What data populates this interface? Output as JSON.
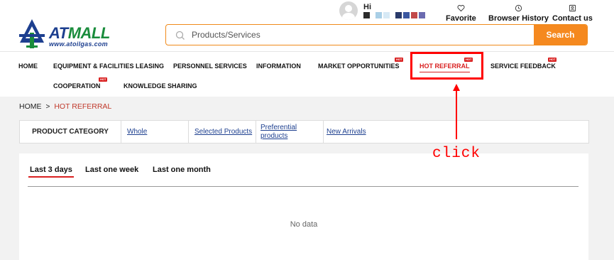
{
  "brand": {
    "logo_name": "AT",
    "logo_name2": "MALL",
    "logo_url": "www.atoilgas.com",
    "primary": "#1d3f8f",
    "green": "#1a8c3c",
    "accent": "#f5891f",
    "hot": "#d92020"
  },
  "user": {
    "greeting": "Hi",
    "avatar_icon": "avatar-icon"
  },
  "top_links": [
    {
      "label": "Favorite",
      "icon": "heart-icon"
    },
    {
      "label": "Browser History",
      "icon": "clock-icon"
    },
    {
      "label": "Contact us",
      "icon": "contact-icon"
    }
  ],
  "search": {
    "placeholder": "Products/Services",
    "button": "Search"
  },
  "nav": {
    "items": [
      {
        "label": "HOME",
        "hot": false
      },
      {
        "label": "EQUIPMENT & FACILITIES LEASING",
        "hot": false
      },
      {
        "label": "PERSONNEL SERVICES",
        "hot": false
      },
      {
        "label": "INFORMATION",
        "hot": false
      },
      {
        "label": "MARKET OPPORTUNITIES",
        "hot": true
      },
      {
        "label": "HOT REFERRAL",
        "hot": true,
        "active": true
      },
      {
        "label": "SERVICE FEEDBACK",
        "hot": true
      },
      {
        "label": "COOPERATION",
        "hot": true
      },
      {
        "label": "KNOWLEDGE SHARING",
        "hot": false
      }
    ],
    "hot_badge": "HOT"
  },
  "breadcrumb": {
    "home": "HOME",
    "sep": ">",
    "current": "HOT REFERRAL"
  },
  "category": {
    "label": "PRODUCT CATEGORY",
    "links": [
      "Whole",
      "Selected Products",
      "Preferential products",
      "New Arrivals"
    ]
  },
  "tabs": [
    {
      "label": "Last 3 days",
      "active": true
    },
    {
      "label": "Last one week",
      "active": false
    },
    {
      "label": "Last one month",
      "active": false
    }
  ],
  "empty_state": "No data",
  "annotation": {
    "text": "click"
  }
}
